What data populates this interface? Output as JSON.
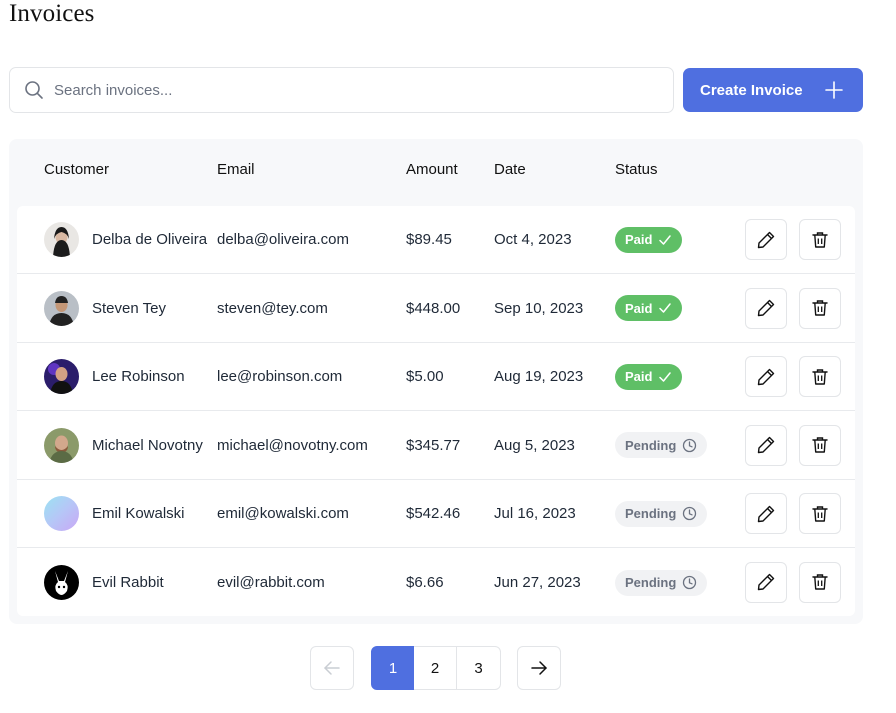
{
  "page": {
    "title": "Invoices"
  },
  "search": {
    "placeholder": "Search invoices..."
  },
  "toolbar": {
    "create_label": "Create Invoice"
  },
  "table": {
    "headers": {
      "customer": "Customer",
      "email": "Email",
      "amount": "Amount",
      "date": "Date",
      "status": "Status"
    },
    "rows": [
      {
        "name": "Delba de Oliveira",
        "email": "delba@oliveira.com",
        "amount": "$89.45",
        "date": "Oct 4, 2023",
        "status": "Paid",
        "status_kind": "paid"
      },
      {
        "name": "Steven Tey",
        "email": "steven@tey.com",
        "amount": "$448.00",
        "date": "Sep 10, 2023",
        "status": "Paid",
        "status_kind": "paid"
      },
      {
        "name": "Lee Robinson",
        "email": "lee@robinson.com",
        "amount": "$5.00",
        "date": "Aug 19, 2023",
        "status": "Paid",
        "status_kind": "paid"
      },
      {
        "name": "Michael Novotny",
        "email": "michael@novotny.com",
        "amount": "$345.77",
        "date": "Aug 5, 2023",
        "status": "Pending",
        "status_kind": "pending"
      },
      {
        "name": "Emil Kowalski",
        "email": "emil@kowalski.com",
        "amount": "$542.46",
        "date": "Jul 16, 2023",
        "status": "Pending",
        "status_kind": "pending"
      },
      {
        "name": "Evil Rabbit",
        "email": "evil@rabbit.com",
        "amount": "$6.66",
        "date": "Jun 27, 2023",
        "status": "Pending",
        "status_kind": "pending"
      }
    ]
  },
  "pagination": {
    "pages": [
      "1",
      "2",
      "3"
    ],
    "current": "1"
  },
  "icons": {
    "search": "search-icon",
    "plus": "plus-icon",
    "edit": "pencil-icon",
    "delete": "trash-icon",
    "paid": "check-icon",
    "pending": "clock-icon",
    "prev": "arrow-left-icon",
    "next": "arrow-right-icon"
  },
  "colors": {
    "accent": "#4f6fe0",
    "paid": "#5fbf66",
    "pending_bg": "#f1f2f4"
  }
}
